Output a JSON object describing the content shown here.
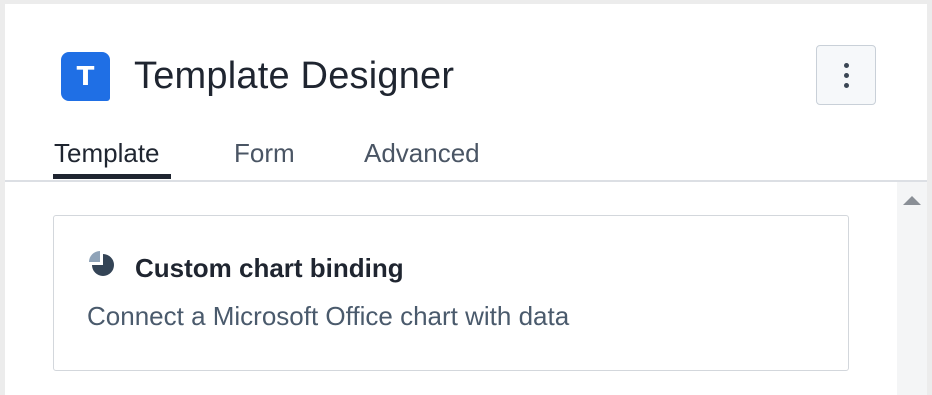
{
  "app": {
    "logo_letter": "T",
    "title": "Template Designer"
  },
  "colors": {
    "brand": "#1f6fe5",
    "text_primary": "#1f2530",
    "text_secondary": "#4a5a6c",
    "border": "#d3d7dc"
  },
  "header": {
    "more_icon": "more-vertical-icon"
  },
  "tabs": [
    {
      "label": "Template",
      "active": true
    },
    {
      "label": "Form",
      "active": false
    },
    {
      "label": "Advanced",
      "active": false
    }
  ],
  "card": {
    "icon": "pie-chart-icon",
    "title": "Custom chart binding",
    "description": "Connect a Microsoft Office chart with data"
  }
}
